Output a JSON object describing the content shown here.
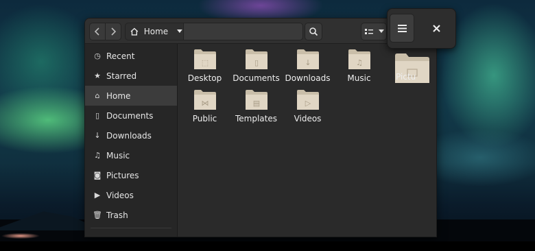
{
  "header": {
    "back_icon": "chevron-left-icon",
    "forward_icon": "chevron-right-icon",
    "path_label": "Home",
    "search_icon": "search-icon",
    "view_icon": "list-view-icon"
  },
  "sidebar": {
    "items": [
      {
        "label": "Recent",
        "icon": "clock-icon",
        "glyph": "◷"
      },
      {
        "label": "Starred",
        "icon": "star-icon",
        "glyph": "★"
      },
      {
        "label": "Home",
        "icon": "home-icon",
        "glyph": "⌂"
      },
      {
        "label": "Documents",
        "icon": "document-icon",
        "glyph": "▯"
      },
      {
        "label": "Downloads",
        "icon": "arrow-down-icon",
        "glyph": "↓"
      },
      {
        "label": "Music",
        "icon": "music-icon",
        "glyph": "♫"
      },
      {
        "label": "Pictures",
        "icon": "camera-icon",
        "glyph": "◙"
      },
      {
        "label": "Videos",
        "icon": "video-icon",
        "glyph": "▶"
      },
      {
        "label": "Trash",
        "icon": "trash-icon",
        "glyph": "🗑"
      }
    ]
  },
  "content": {
    "folders": [
      {
        "label": "Desktop",
        "icon": "folder-desktop-icon",
        "emblem": "⬚"
      },
      {
        "label": "Documents",
        "icon": "folder-documents-icon",
        "emblem": "▯"
      },
      {
        "label": "Downloads",
        "icon": "folder-downloads-icon",
        "emblem": "↓"
      },
      {
        "label": "Music",
        "icon": "folder-music-icon",
        "emblem": "♫"
      },
      {
        "label": "Public",
        "icon": "folder-public-icon",
        "emblem": "⋈"
      },
      {
        "label": "Templates",
        "icon": "folder-templates-icon",
        "emblem": "▤"
      },
      {
        "label": "Videos",
        "icon": "folder-videos-icon",
        "emblem": "▷"
      }
    ],
    "dragged_label": "Pictu"
  },
  "popover": {
    "menu_icon": "hamburger-icon",
    "close_icon": "close-icon"
  },
  "colors": {
    "window_bg": "#2a2a2a",
    "folder": "#e0d6c4",
    "folder_tab": "#c9bea9",
    "text": "#eeeeee"
  }
}
